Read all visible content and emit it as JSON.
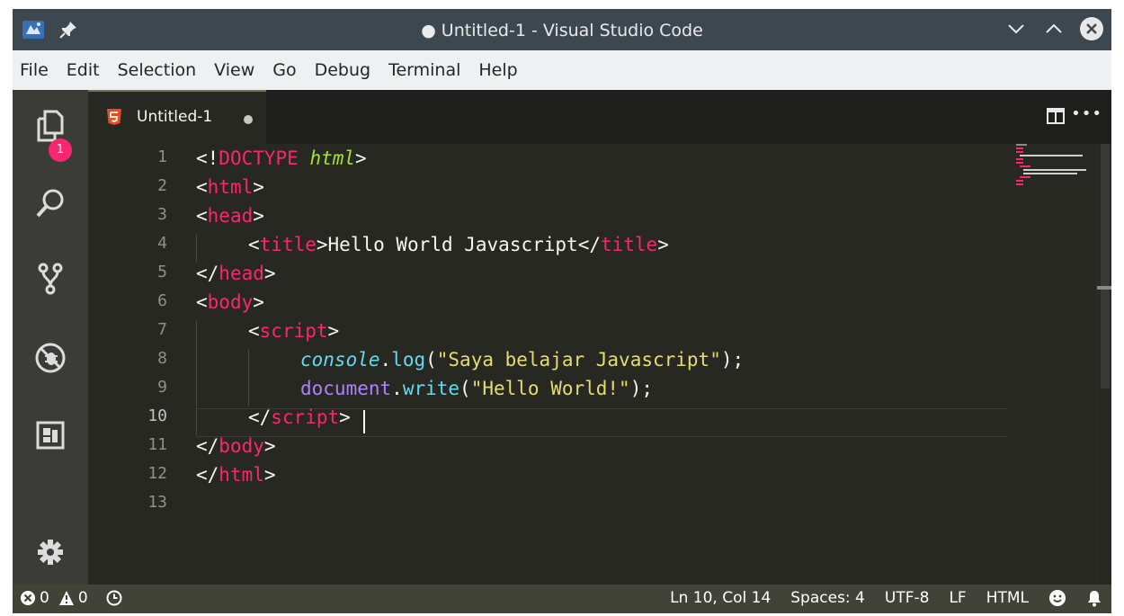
{
  "window": {
    "title": "● Untitled-1 - Visual Studio Code"
  },
  "menu": {
    "items": [
      "File",
      "Edit",
      "Selection",
      "View",
      "Go",
      "Debug",
      "Terminal",
      "Help"
    ]
  },
  "activity_bar": {
    "icons": [
      "explorer-icon",
      "search-icon",
      "source-control-icon",
      "debug-icon",
      "extensions-icon",
      "settings-gear-icon"
    ],
    "explorer_badge": "1"
  },
  "tab": {
    "label": "Untitled-1",
    "icon": "html5-file-icon",
    "dirty": true
  },
  "editor": {
    "active_line": 10,
    "lines": [
      {
        "n": "1"
      },
      {
        "n": "2"
      },
      {
        "n": "3"
      },
      {
        "n": "4"
      },
      {
        "n": "5"
      },
      {
        "n": "6"
      },
      {
        "n": "7"
      },
      {
        "n": "8"
      },
      {
        "n": "9"
      },
      {
        "n": "10"
      },
      {
        "n": "11"
      },
      {
        "n": "12"
      },
      {
        "n": "13"
      }
    ],
    "code": {
      "l1_open": "<!",
      "l1_doctype": "DOCTYPE",
      "l1_space": " ",
      "l1_html": "html",
      "l1_close": ">",
      "l2_lt": "<",
      "l2_tag": "html",
      "l2_gt": ">",
      "l3_lt": "<",
      "l3_tag": "head",
      "l3_gt": ">",
      "l4_lt": "<",
      "l4_tag": "title",
      "l4_gt": ">",
      "l4_text": "Hello World Javascript",
      "l4_lt2": "</",
      "l4_tag2": "title",
      "l4_gt2": ">",
      "l5_lt": "</",
      "l5_tag": "head",
      "l5_gt": ">",
      "l6_lt": "<",
      "l6_tag": "body",
      "l6_gt": ">",
      "l7_lt": "<",
      "l7_tag": "script",
      "l7_gt": ">",
      "l8_obj": "console",
      "l8_dot": ".",
      "l8_fn": "log",
      "l8_p1": "(",
      "l8_str": "\"Saya belajar Javascript\"",
      "l8_p2": ");",
      "l9_obj": "document",
      "l9_dot": ".",
      "l9_fn": "write",
      "l9_p1": "(",
      "l9_str": "\"Hello World!\"",
      "l9_p2": ");",
      "l10_lt": "</",
      "l10_tag": "script",
      "l10_gt": ">",
      "l11_lt": "</",
      "l11_tag": "body",
      "l11_gt": ">",
      "l12_lt": "</",
      "l12_tag": "html",
      "l12_gt": ">"
    }
  },
  "status_bar": {
    "errors": "0",
    "warnings": "0",
    "position": "Ln 10, Col 14",
    "spaces": "Spaces: 4",
    "encoding": "UTF-8",
    "eol": "LF",
    "language": "HTML"
  },
  "colors": {
    "tag": "#f92672",
    "string": "#e6db74",
    "keyword": "#66d9ef",
    "doctype_name": "#a6e22e",
    "badge": "#f92672",
    "status_bar": "#414339"
  }
}
